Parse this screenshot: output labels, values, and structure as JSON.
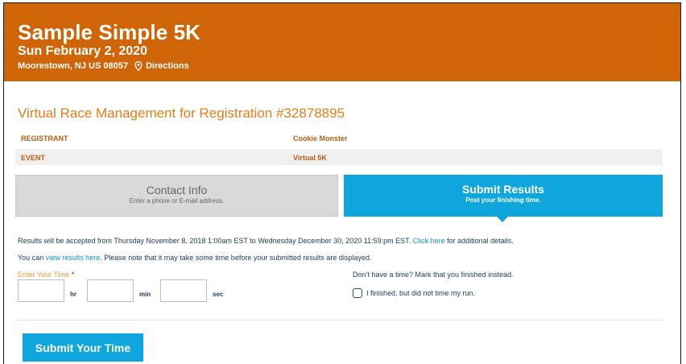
{
  "header": {
    "event_title": "Sample Simple 5K",
    "event_date": "Sun February 2, 2020",
    "location": "Moorestown, NJ US 08057",
    "directions_link": "Directions",
    "pin_icon": "location-pin-icon"
  },
  "page_heading": "Virtual Race Management for Registration #32878895",
  "info": {
    "registrant_label": "REGISTRANT",
    "registrant_value": "Cookie Monster",
    "event_label": "EVENT",
    "event_value": "Virtual 5K"
  },
  "tabs": {
    "contact": {
      "title": "Contact Info",
      "subtitle": "Enter a phone or E-mail address."
    },
    "submit": {
      "title": "Submit Results",
      "subtitle": "Post your finishing time."
    }
  },
  "notice": {
    "accepted_prefix": "Results will be accepted from Thursday November 8, 2018 1:00am EST to Wednesday December 30, 2020 11:59:pm EST. ",
    "click_here": "Click here",
    "accepted_suffix": " for additional details.",
    "view_prefix": "You can ",
    "view_link": "view results here",
    "view_suffix": ". Please note that it may take some time before your submitted results are displayed."
  },
  "time_form": {
    "label": "Enter Your Time",
    "required_mark": "*",
    "hours_value": "",
    "minutes_value": "",
    "seconds_value": "",
    "hr_unit": "hr",
    "min_unit": "min",
    "sec_unit": "sec"
  },
  "finished": {
    "question": "Don’t have a time? Mark that you finished instead.",
    "checkbox_label": "I finished, but did not time my run.",
    "checked": false
  },
  "submit_button": "Submit Your Time",
  "colors": {
    "banner": "#cf6507",
    "accent_blue": "#0fa5dd",
    "heading_orange": "#e37f18"
  }
}
